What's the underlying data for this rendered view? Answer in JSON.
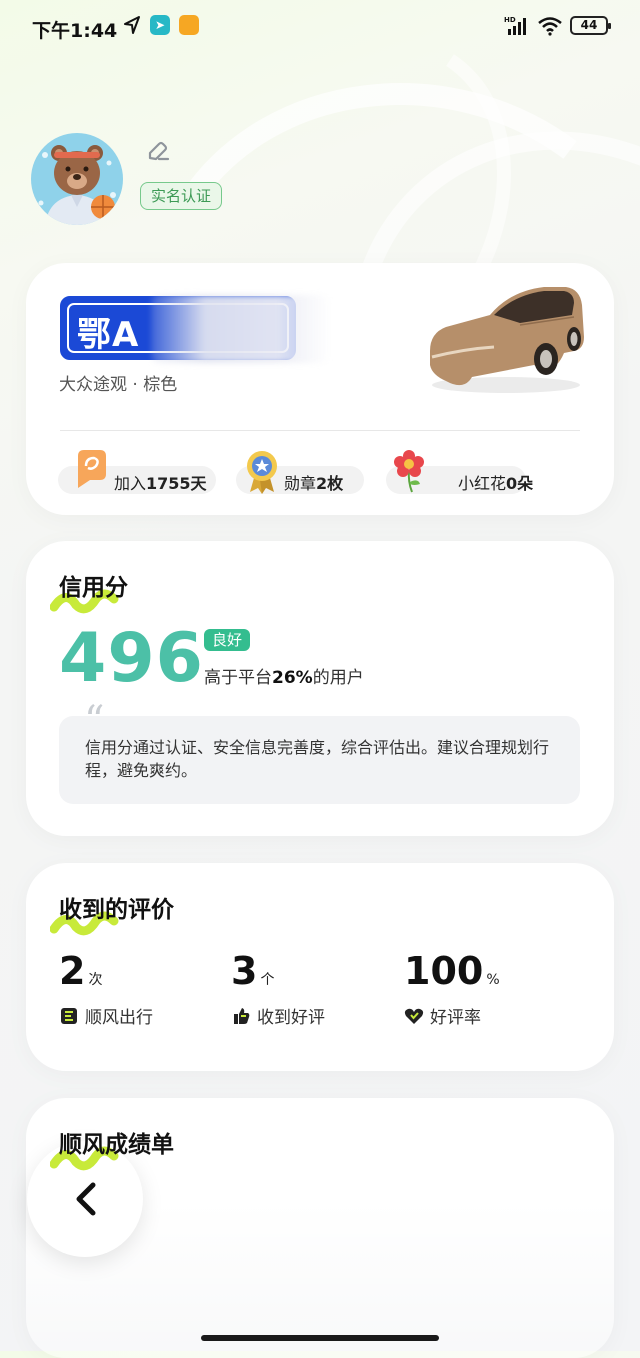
{
  "status_bar": {
    "time": "下午1:44",
    "app_icon_1": "navigation-app-icon",
    "app_icon_2": "news-app-icon",
    "battery": "44"
  },
  "profile": {
    "username": "",
    "verify_badge": "实名认证"
  },
  "car": {
    "plate": "鄂A",
    "description": "大众途观 · 棕色",
    "stats": [
      {
        "icon": "calendar-badge-icon",
        "prefix": "加入",
        "value": "1755",
        "suffix": "天"
      },
      {
        "icon": "medal-icon",
        "prefix": "勋章",
        "value": "2",
        "suffix": "枚"
      },
      {
        "icon": "red-flower-icon",
        "prefix": "小红花",
        "value": "0",
        "suffix": "朵"
      }
    ]
  },
  "credit": {
    "title": "信用分",
    "score": "496",
    "rating": "良好",
    "beat_prefix": "高于平台",
    "beat_value": "26%",
    "beat_suffix": "的用户",
    "description": "信用分通过认证、安全信息完善度，综合评估出。建议合理规划行程，避免爽约。"
  },
  "reviews": {
    "title": "收到的评价",
    "items": [
      {
        "value": "2",
        "unit": "次",
        "label": "顺风出行",
        "icon": "ride-icon"
      },
      {
        "value": "3",
        "unit": "个",
        "label": "收到好评",
        "icon": "thumbs-up-icon"
      },
      {
        "value": "100",
        "unit": "%",
        "label": "好评率",
        "icon": "heart-icon"
      }
    ]
  },
  "report": {
    "title": "顺风成绩单"
  },
  "colors": {
    "score": "#4cc0a7",
    "rating_tag": "#34bd8f",
    "plate": "#1b49d6",
    "highlight": "#c8ea3a"
  }
}
